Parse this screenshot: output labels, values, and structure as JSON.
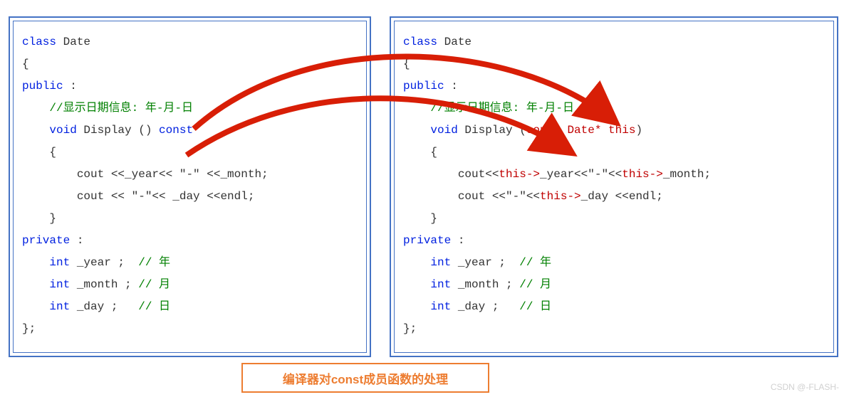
{
  "left": {
    "l1_class": "class",
    "l1_name": " Date",
    "l2": "{",
    "l3_public": "public",
    "l3_colon": " :",
    "l4_indent": "    ",
    "l4_cm": "//显示日期信息: 年-月-日",
    "l5_indent": "    ",
    "l5_void": "void",
    "l5_disp": " Display () ",
    "l5_const": "const",
    "l6": "    {",
    "l7": "        cout <<_year<< \"-\" <<_month;",
    "l8": "        cout << \"-\"<< _day <<endl;",
    "l9": "    }",
    "l10_priv": "private",
    "l10_colon": " :",
    "l11_i": "    ",
    "l11_int": "int",
    "l11_v": " _year ;  ",
    "l11_cm": "// 年",
    "l12_i": "    ",
    "l12_int": "int",
    "l12_v": " _month ; ",
    "l12_cm": "// 月",
    "l13_i": "    ",
    "l13_int": "int",
    "l13_v": " _day ;   ",
    "l13_cm": "// 日",
    "l14": "};"
  },
  "right": {
    "l1_class": "class",
    "l1_name": " Date",
    "l2": "{",
    "l3_public": "public",
    "l3_colon": " :",
    "l4_indent": "    ",
    "l4_cm": "//显示日期信息: 年-月-日",
    "l5_indent": "    ",
    "l5_void": "void",
    "l5_disp": " Display (",
    "l5_param": "const Date* this",
    "l5_close": ")",
    "l6": "    {",
    "l7_a": "        cout<<",
    "l7_t1": "this->",
    "l7_b": "_year<<\"-\"<<",
    "l7_t2": "this->",
    "l7_c": "_month;",
    "l8_a": "        cout <<\"-\"<<",
    "l8_t1": "this->",
    "l8_b": "_day <<endl;",
    "l9": "    }",
    "l10_priv": "private",
    "l10_colon": " :",
    "l11_i": "    ",
    "l11_int": "int",
    "l11_v": " _year ;  ",
    "l11_cm": "// 年",
    "l12_i": "    ",
    "l12_int": "int",
    "l12_v": " _month ; ",
    "l12_cm": "// 月",
    "l13_i": "    ",
    "l13_int": "int",
    "l13_v": " _day ;   ",
    "l13_cm": "// 日",
    "l14": "};"
  },
  "caption": "编译器对const成员函数的处理",
  "watermark": "CSDN @-FLASH-"
}
